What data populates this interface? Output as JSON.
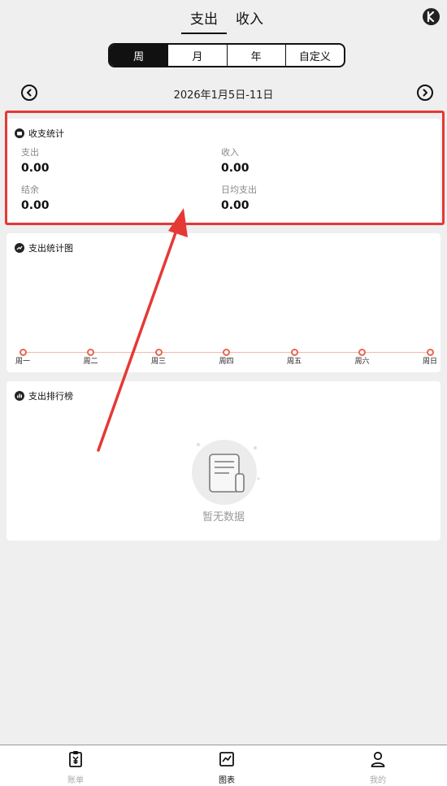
{
  "top_tabs": {
    "expense": "支出",
    "income": "收入",
    "active": "expense"
  },
  "period": {
    "options": [
      "周",
      "月",
      "年",
      "自定义"
    ],
    "active_index": 0
  },
  "date_range": "2026年1月5日-11日",
  "summary": {
    "title": "收支统计",
    "expense_label": "支出",
    "expense_value": "0.00",
    "income_label": "收入",
    "income_value": "0.00",
    "balance_label": "结余",
    "balance_value": "0.00",
    "daily_avg_label": "日均支出",
    "daily_avg_value": "0.00"
  },
  "chart_card": {
    "title": "支出统计图"
  },
  "chart_data": {
    "type": "line",
    "categories": [
      "周一",
      "周二",
      "周三",
      "周四",
      "周五",
      "周六",
      "周日"
    ],
    "series": [
      {
        "values": [
          0,
          0,
          0,
          0,
          0,
          0,
          0
        ]
      }
    ],
    "color": "#e8654f",
    "grid": false
  },
  "ranking": {
    "title": "支出排行榜",
    "empty_text": "暂无数据"
  },
  "bottom_nav": {
    "items": [
      {
        "label": "账单",
        "icon": "clipboard-yen-icon"
      },
      {
        "label": "图表",
        "icon": "chart-icon"
      },
      {
        "label": "我的",
        "icon": "person-icon"
      }
    ],
    "active_index": 1
  },
  "colors": {
    "highlight": "#e53935",
    "accent": "#e8654f",
    "active_segment": "#111111"
  }
}
